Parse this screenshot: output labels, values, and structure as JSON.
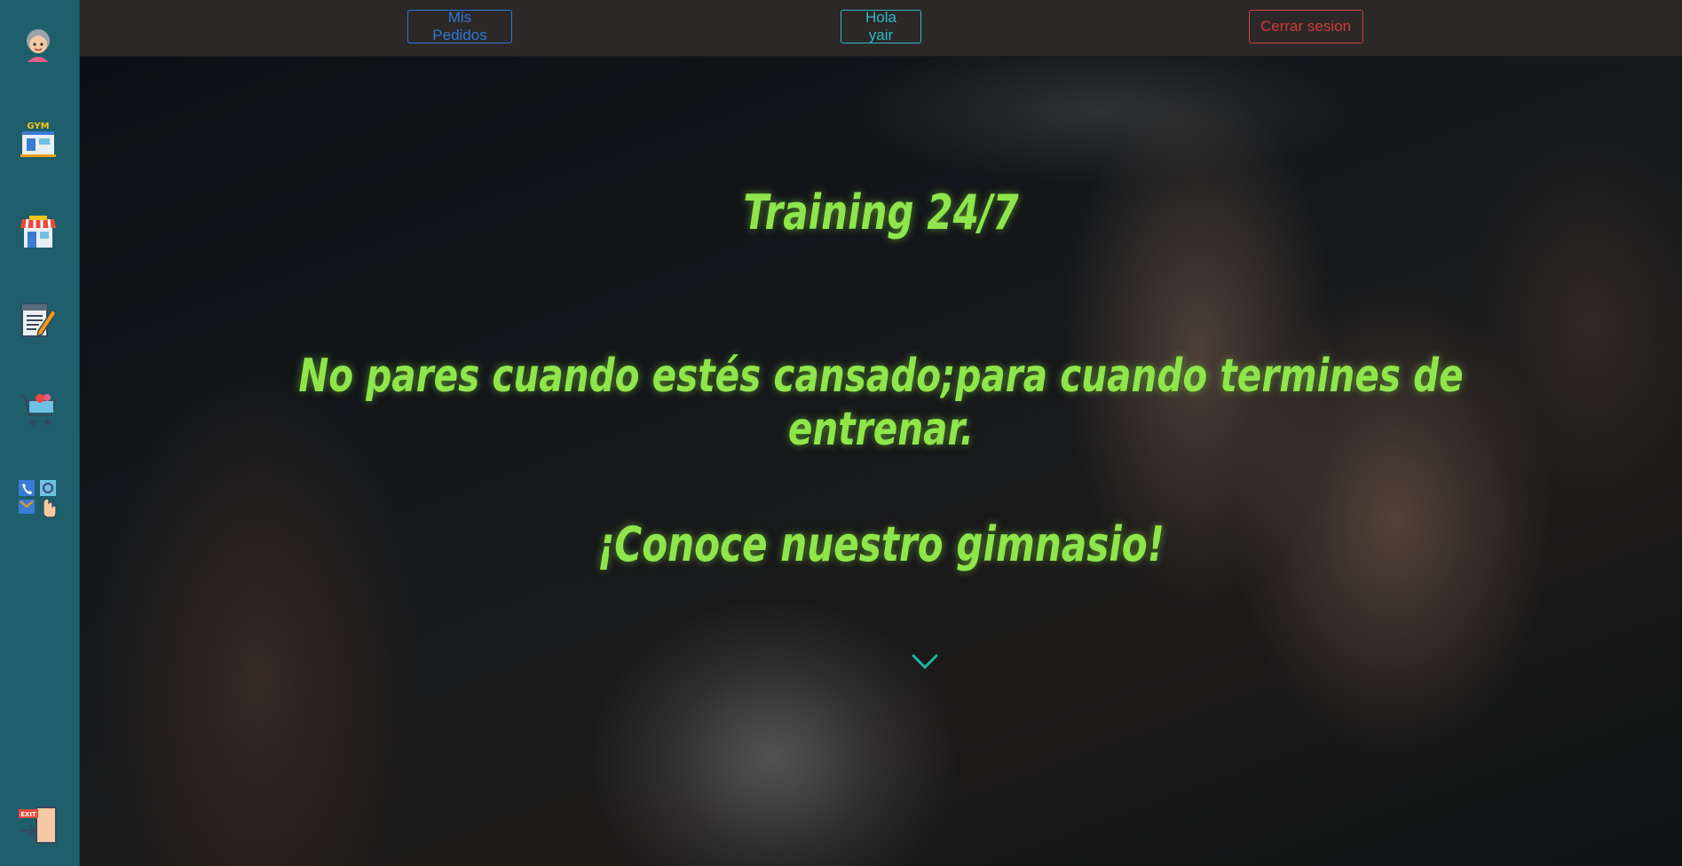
{
  "topbar": {
    "orders_label": "Mis Pedidos",
    "greeting_label": "Hola yair",
    "logout_label": "Cerrar sesion"
  },
  "sidebar": {
    "items": [
      {
        "name": "profile",
        "icon": "avatar-icon"
      },
      {
        "name": "gym",
        "icon": "gym-icon",
        "label": "GYM"
      },
      {
        "name": "store",
        "icon": "store-icon"
      },
      {
        "name": "routines",
        "icon": "notepad-icon"
      },
      {
        "name": "cart",
        "icon": "shopping-cart-icon"
      },
      {
        "name": "contact",
        "icon": "contact-icon"
      },
      {
        "name": "exit",
        "icon": "exit-icon",
        "label": "EXIT"
      }
    ]
  },
  "hero": {
    "title": "Training 24/7",
    "motto": "No pares cuando estés cansado;para cuando termines de entrenar.",
    "cta": "¡Conoce nuestro gimnasio!"
  },
  "colors": {
    "sidebar": "#1e5f6b",
    "topbar": "#2b2827",
    "hero_text": "#8ee64a",
    "orders_btn": "#2f78d8",
    "greeting_btn": "#2fb8c7",
    "logout_btn": "#d43a3a",
    "chevron": "#1fb3a8"
  }
}
